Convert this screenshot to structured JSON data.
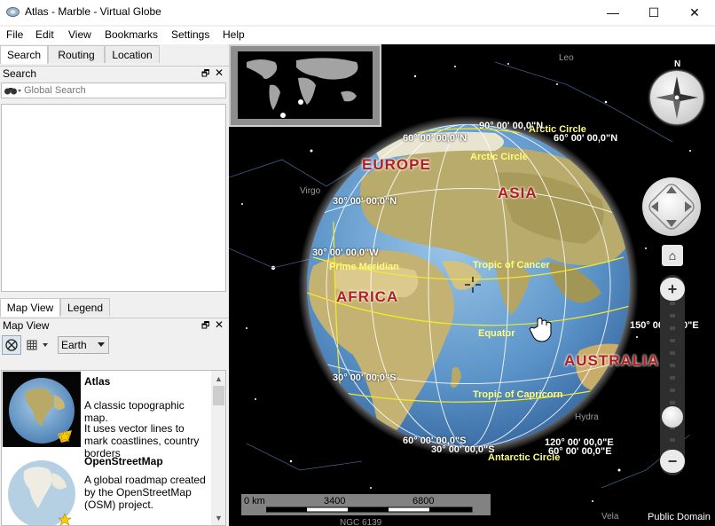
{
  "window": {
    "title": "Atlas - Marble - Virtual Globe",
    "min_glyph": "—",
    "max_glyph": "☐",
    "close_glyph": "✕"
  },
  "menu": [
    "File",
    "Edit",
    "View",
    "Bookmarks",
    "Settings",
    "Help"
  ],
  "top_tabs": [
    "Search",
    "Routing",
    "Location"
  ],
  "search_dock": {
    "title": "Search",
    "float_glyph": "🗗",
    "close_glyph": "✕",
    "placeholder": "Global Search",
    "icon": "binoculars-icon"
  },
  "bottom_tabs": [
    "Map View",
    "Legend"
  ],
  "mapview_dock": {
    "title": "Map View",
    "float_glyph": "🗗",
    "close_glyph": "✕",
    "celestial_body": "Earth"
  },
  "map_themes": [
    {
      "name": "Atlas",
      "desc_html": "A classic topographic map.",
      "desc2": "It uses vector lines to mark coastlines, country borders"
    },
    {
      "name": "OpenStreetMap",
      "desc_html": "A global roadmap created by the OpenStreetMap (OSM) project.",
      "desc2": ""
    }
  ],
  "map": {
    "continents": [
      "EUROPE",
      "ASIA",
      "AFRICA",
      "AUSTRALIA"
    ],
    "lines": {
      "arctic": "Arctic Circle",
      "arctic2": "Arctic Circle",
      "prime": "Prime Meridian",
      "cancer": "Tropic of Cancer",
      "equator": "Equator",
      "capricorn": "Tropic of Capricorn",
      "antarctic": "Antarctic Circle"
    },
    "grid": {
      "n90": "90° 00' 00,0\"N",
      "n60a": "60° 00' 00,0\"N",
      "n60b": "60° 00' 00,0\"N",
      "n30": "30° 00' 00,0\"N",
      "w30": "30° 00' 00,0\"W",
      "s30": "30° 00' 00,0\"S",
      "s60": "60° 00' 00,0\"S",
      "s90": "30° 00' 00,0\"S",
      "e120": "120° 00' 00,0\"E",
      "e150": "150° 00' 00,0\"E",
      "e60": "60° 00' 00,0\"E"
    },
    "stars": [
      "Leo",
      "Virgo",
      "Vela",
      "Hydra",
      "NGC 6139"
    ],
    "compass_n": "N",
    "zoom_in": "+",
    "zoom_out": "−",
    "home": "⌂",
    "scale": {
      "zero": "0 km",
      "mid": "3400",
      "max": "6800"
    },
    "attribution": "Public Domain"
  }
}
